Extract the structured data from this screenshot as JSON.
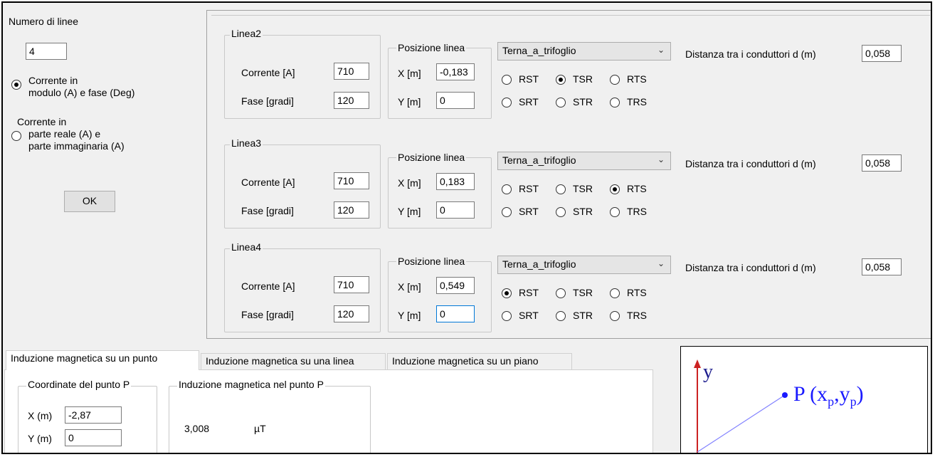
{
  "left": {
    "num_lines_label": "Numero di linee",
    "num_lines_value": "4",
    "radio1_label_a": "Corrente in",
    "radio1_label_b": "modulo (A) e fase (Deg)",
    "radio2_label_a": "Corrente in",
    "radio2_label_b": "parte reale (A) e",
    "radio2_label_c": "parte immaginaria (A)",
    "radio_selected": 1,
    "ok_label": "OK"
  },
  "labels": {
    "corrente": "Corrente [A]",
    "fase": "Fase [gradi]",
    "posizione": "Posizione linea",
    "x": "X [m]",
    "y": "Y [m]",
    "distanza": "Distanza tra i conduttori d (m)",
    "rst": "RST",
    "tsr": "TSR",
    "rts": "RTS",
    "srt": "SRT",
    "str": "STR",
    "trs": "TRS"
  },
  "lines": [
    {
      "title": "Linea2",
      "corrente": "710",
      "fase": "120",
      "x": "-0,183",
      "y": "0",
      "terna": "Terna_a_trifoglio",
      "distanza": "0,058",
      "phase_selected": "TSR"
    },
    {
      "title": "Linea3",
      "corrente": "710",
      "fase": "120",
      "x": "0,183",
      "y": "0",
      "terna": "Terna_a_trifoglio",
      "distanza": "0,058",
      "phase_selected": "RTS"
    },
    {
      "title": "Linea4",
      "corrente": "710",
      "fase": "120",
      "x": "0,549",
      "y": "0",
      "terna": "Terna_a_trifoglio",
      "distanza": "0,058",
      "phase_selected": "RST"
    }
  ],
  "tabs": [
    {
      "label": "Induzione magnetica su un punto",
      "active": true
    },
    {
      "label": "Induzione magnetica su una linea",
      "active": false
    },
    {
      "label": "Induzione magnetica su un piano",
      "active": false
    }
  ],
  "point": {
    "group_label": "Coordinate del punto P",
    "x_label": "X (m)",
    "x_value": "-2,87",
    "y_label": "Y (m)",
    "y_value": "0"
  },
  "result": {
    "group_label": "Induzione magnetica nel punto P",
    "value": "3,008",
    "unit": "µT"
  },
  "diagram": {
    "axis_label": "y",
    "point_label": "P (x",
    "sub_p": "p",
    "comma_y": ",y",
    "close": ")"
  },
  "colors": {
    "accent_red": "#cc2222",
    "point_blue": "#1a1aff",
    "line_blue": "#8080ff"
  }
}
